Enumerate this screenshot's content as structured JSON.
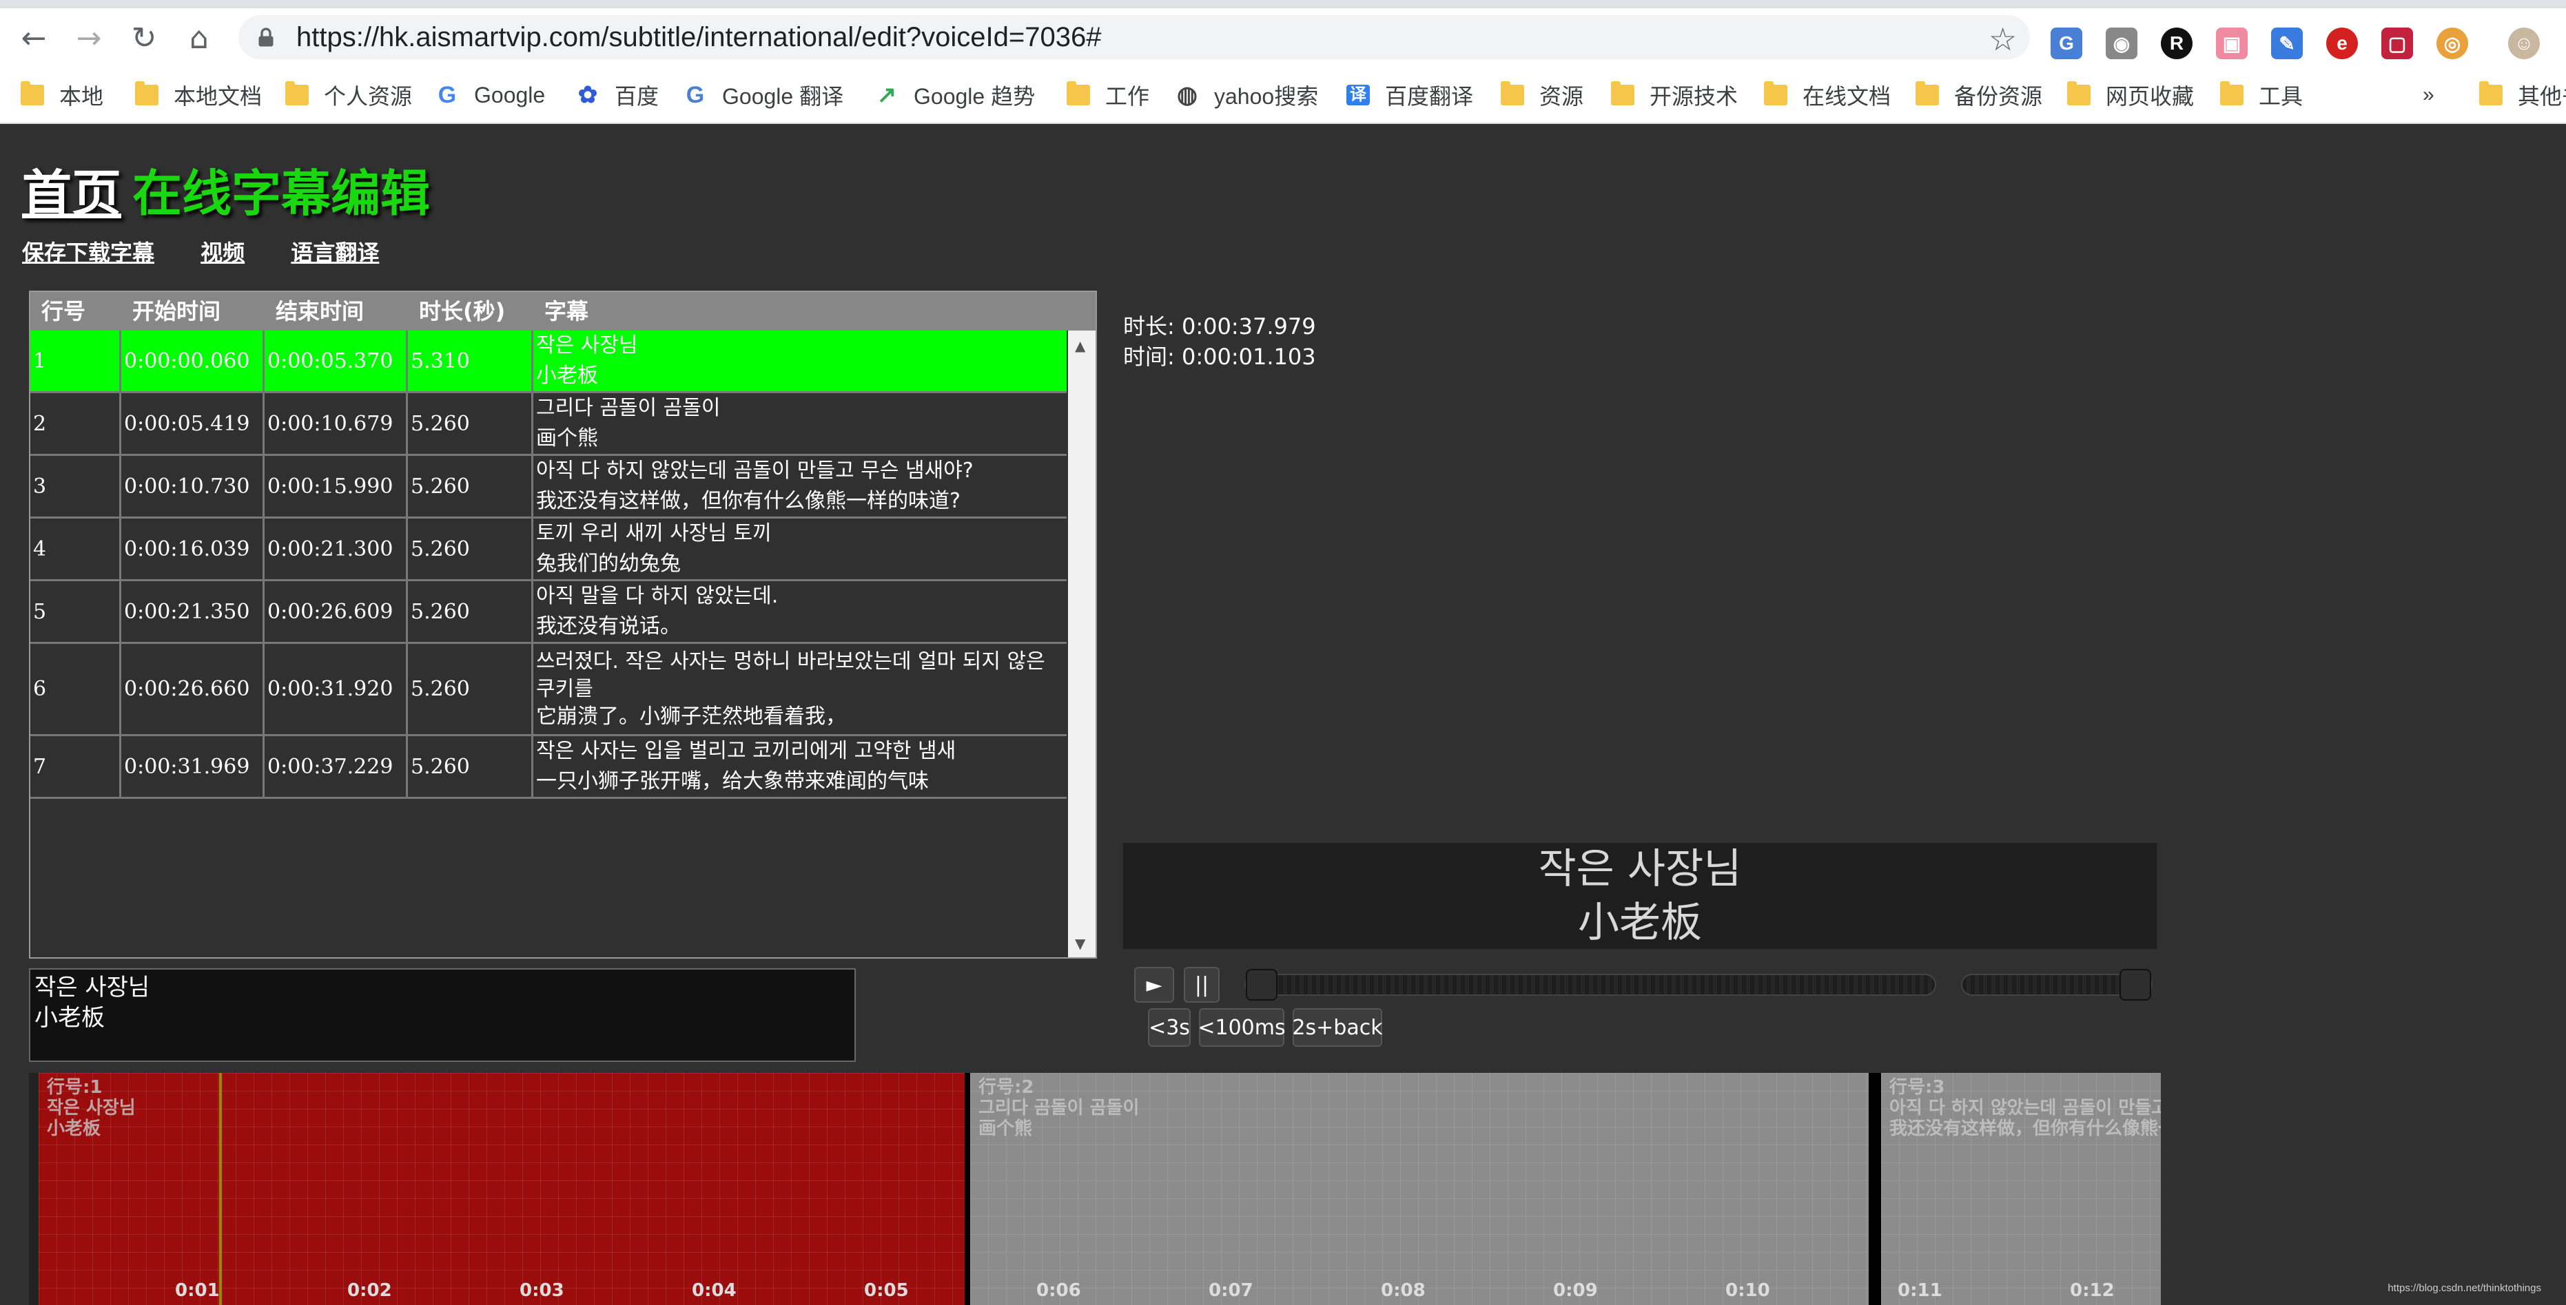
{
  "browser": {
    "url": "https://hk.aismartvip.com/subtitle/international/edit?voiceId=7036#",
    "bookmarks": [
      "本地",
      "本地文档",
      "个人资源",
      "Google",
      "百度",
      "Google 翻译",
      "Google 趋势",
      "工作",
      "yahoo搜索",
      "百度翻译",
      "资源",
      "开源技术",
      "在线文档",
      "备份资源",
      "网页收藏",
      "工具"
    ],
    "more_bookmarks": "»",
    "other_bookmarks": "其他书签"
  },
  "header": {
    "home": "首页",
    "title": "在线字幕编辑",
    "links": [
      "保存下载字幕",
      "视频",
      "语言翻译"
    ]
  },
  "table": {
    "columns": [
      "行号",
      "开始时间",
      "结束时间",
      "时长(秒)",
      "字幕"
    ],
    "rows": [
      {
        "no": "1",
        "start": "0:00:00.060",
        "end": "0:00:05.370",
        "dur": "5.310",
        "ko": "작은 사장님",
        "zh": "小老板"
      },
      {
        "no": "2",
        "start": "0:00:05.419",
        "end": "0:00:10.679",
        "dur": "5.260",
        "ko": "그리다 곰돌이 곰돌이",
        "zh": "画个熊"
      },
      {
        "no": "3",
        "start": "0:00:10.730",
        "end": "0:00:15.990",
        "dur": "5.260",
        "ko": "아직 다 하지 않았는데 곰돌이 만들고 무슨 냄새야?",
        "zh": "我还没有这样做，但你有什么像熊一样的味道?"
      },
      {
        "no": "4",
        "start": "0:00:16.039",
        "end": "0:00:21.300",
        "dur": "5.260",
        "ko": "토끼 우리 새끼 사장님 토끼",
        "zh": "兔我们的幼兔兔"
      },
      {
        "no": "5",
        "start": "0:00:21.350",
        "end": "0:00:26.609",
        "dur": "5.260",
        "ko": "아직 말을 다 하지 않았는데.",
        "zh": "我还没有说话。"
      },
      {
        "no": "6",
        "start": "0:00:26.660",
        "end": "0:00:31.920",
        "dur": "5.260",
        "ko": "쓰러졌다. 작은 사자는 멍하니 바라보았는데 얼마 되지 않은 쿠키를",
        "zh": "它崩溃了。小狮子茫然地看着我，"
      },
      {
        "no": "7",
        "start": "0:00:31.969",
        "end": "0:00:37.229",
        "dur": "5.260",
        "ko": "작은 사자는 입을 벌리고 코끼리에게 고약한 냄새",
        "zh": "一只小狮子张开嘴，给大象带来难闻的气味"
      }
    ]
  },
  "info": {
    "duration": "时长: 0:00:37.979",
    "time": "时间: 0:00:01.103"
  },
  "preview": {
    "line1": "작은 사장님",
    "line2": "小老板"
  },
  "player": {
    "play": "►",
    "pause": "||",
    "back3s": "<3s",
    "back100ms": "<100ms",
    "back2s": "2s+back",
    "progress": 0.0,
    "volume": 1.0
  },
  "edit": {
    "line1": "작은 사장님",
    "line2": "小老板"
  },
  "timeline": {
    "segments": [
      {
        "label": "行号:1",
        "ko": "작은 사장님",
        "zh": "小老板"
      },
      {
        "label": "行号:2",
        "ko": "그리다 곰돌이 곰돌이",
        "zh": "画个熊"
      },
      {
        "label": "行号:3",
        "ko": "아직 다 하지 않았는데 곰돌이 만들고",
        "zh": "我还没有这样做，但你有什么像熊一"
      }
    ],
    "ticks": [
      "0:01",
      "0:02",
      "0:03",
      "0:04",
      "0:05",
      "0:06",
      "0:07",
      "0:08",
      "0:09",
      "0:10",
      "0:11",
      "0:12"
    ]
  },
  "watermark": "https://blog.csdn.net/thinktothings",
  "colors": {
    "active_row": "#00ff00",
    "accent_title": "#19d80f",
    "segment_active": "#9b0d0d",
    "segment": "#8c8c8c"
  }
}
